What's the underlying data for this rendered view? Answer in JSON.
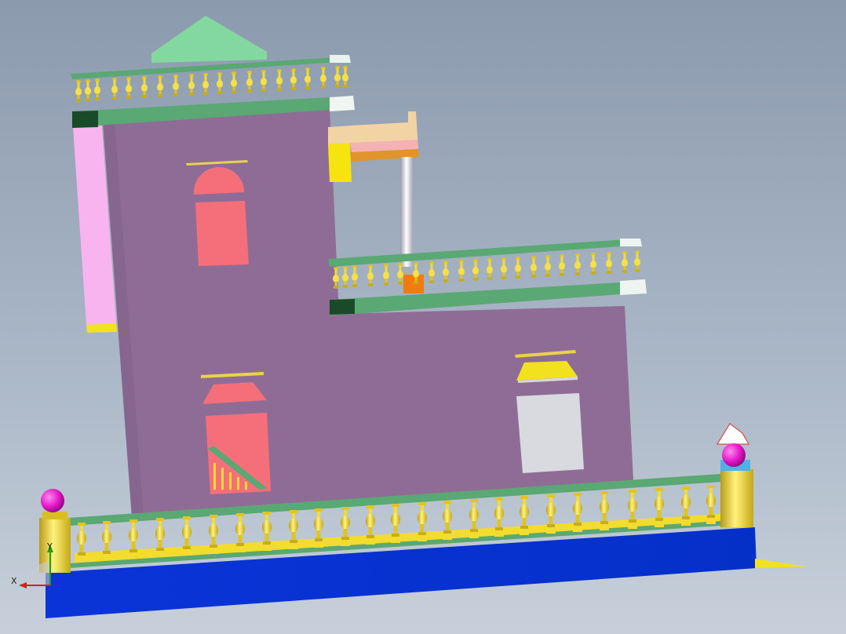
{
  "viewport": {
    "background_top": "#8c9aae",
    "background_bottom": "#c7d0da"
  },
  "triad": {
    "x_label": "X",
    "y_label": "Y"
  },
  "model": {
    "name_hidden": true,
    "colors": {
      "wall": "#8f6c96",
      "window": "#f56f7a",
      "base": "#0533d6",
      "rail": "#5aa873",
      "baluster": "#f2dc2e",
      "finial": "#e416c8",
      "pilaster": "#f4d53f",
      "roof_gable": "#83d8a0",
      "side_panel": "#f8b4ef",
      "pipe": "#e8e8f0"
    }
  }
}
